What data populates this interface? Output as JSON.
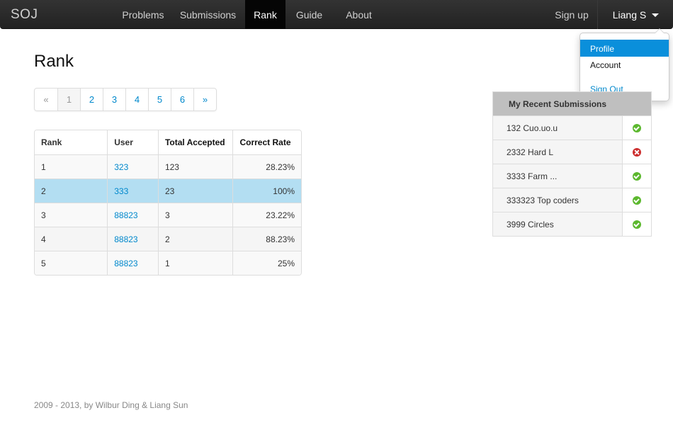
{
  "navbar": {
    "brand": "SOJ",
    "items": [
      {
        "label": "Problems",
        "active": false
      },
      {
        "label": "Submissions",
        "active": false
      },
      {
        "label": "Rank",
        "active": true
      },
      {
        "label": "Guide",
        "active": false
      },
      {
        "label": "About",
        "active": false
      }
    ],
    "signup": "Sign up",
    "user": "Liang S"
  },
  "user_menu": {
    "items": [
      "Profile",
      "Account"
    ],
    "selected": "Profile",
    "signout": "Sign Out"
  },
  "page": {
    "title": "Rank"
  },
  "pagination": {
    "prev": "«",
    "pages": [
      "1",
      "2",
      "3",
      "4",
      "5",
      "6"
    ],
    "current": "1",
    "next": "»"
  },
  "rank_table": {
    "headers": [
      "Rank",
      "User",
      "Total Accepted",
      "Correct Rate"
    ],
    "rows": [
      {
        "rank": "1",
        "user": "323",
        "accepted": "123",
        "rate": "28.23%"
      },
      {
        "rank": "2",
        "user": "333",
        "accepted": "23",
        "rate": "100%"
      },
      {
        "rank": "3",
        "user": "88823",
        "accepted": "3",
        "rate": "23.22%"
      },
      {
        "rank": "4",
        "user": "88823",
        "accepted": "2",
        "rate": "88.23%"
      },
      {
        "rank": "5",
        "user": "88823",
        "accepted": "1",
        "rate": "25%"
      }
    ],
    "highlighted_row": "2"
  },
  "recent": {
    "title": "My Recent Submissions",
    "items": [
      {
        "label": "132 Cuo.uo.u",
        "status": "check-icon"
      },
      {
        "label": "2332 Hard L",
        "status": "cross-icon"
      },
      {
        "label": "3333 Farm ...",
        "status": "check-icon"
      },
      {
        "label": "333323 Top coders",
        "status": "check-icon"
      },
      {
        "label": "3999 Circles",
        "status": "check-icon"
      }
    ]
  },
  "footer": {
    "text": "2009 - 2013, by Wilbur Ding & Liang Sun"
  },
  "colors": {
    "accent": "#0088cc",
    "selected": "#0a8fdb",
    "highlight_row": "#b3def2",
    "ok": "#5cb82e",
    "error": "#cc2d2d"
  }
}
